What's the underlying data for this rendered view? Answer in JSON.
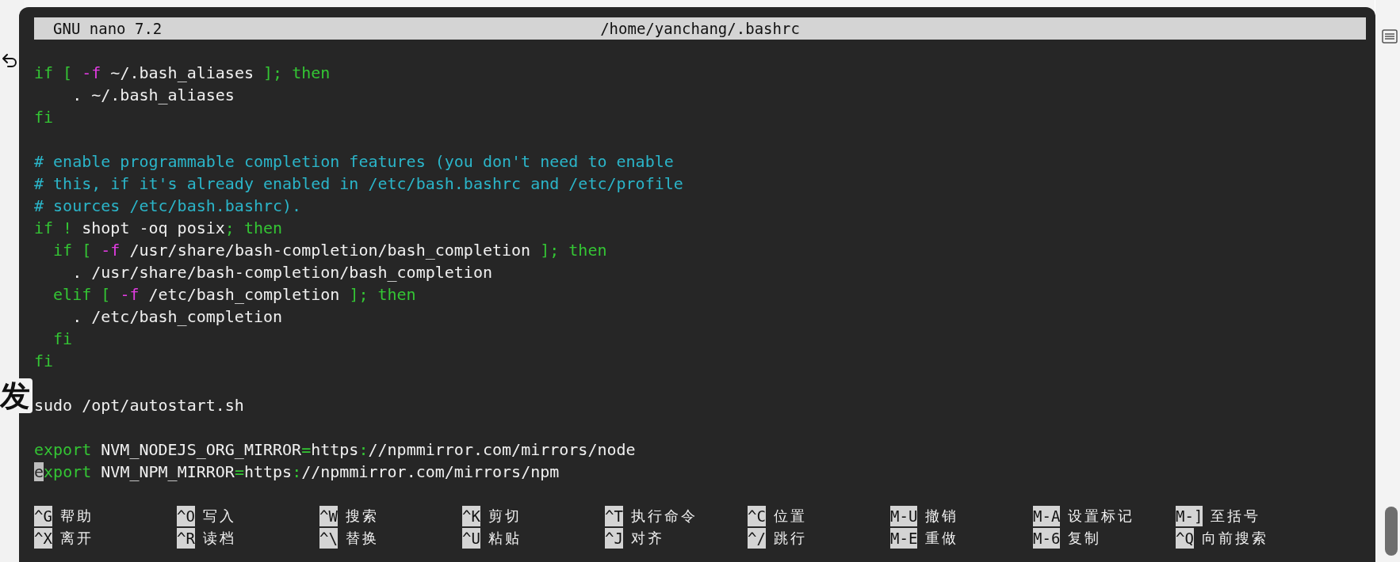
{
  "page": {
    "heading_fragment": "发"
  },
  "nano": {
    "title_left": "GNU nano 7.2",
    "title_file": "/home/yanchang/.bashrc",
    "lines": [
      {
        "kind": "code",
        "segments": [
          {
            "text": "if [ ",
            "kind": "keyword"
          },
          {
            "text": "-f",
            "kind": "flag"
          },
          {
            "text": " ~/.bash_aliases ",
            "kind": "plain"
          },
          {
            "text": "]; then",
            "kind": "keyword"
          }
        ]
      },
      {
        "kind": "code",
        "segments": [
          {
            "text": "    . ~/.bash_aliases",
            "kind": "plain"
          }
        ]
      },
      {
        "kind": "code",
        "segments": [
          {
            "text": "fi",
            "kind": "keyword"
          }
        ]
      },
      {
        "kind": "blank"
      },
      {
        "kind": "code",
        "segments": [
          {
            "text": "# enable programmable completion features (you don't need to enable",
            "kind": "comment"
          }
        ]
      },
      {
        "kind": "code",
        "segments": [
          {
            "text": "# this, if it's already enabled in /etc/bash.bashrc and /etc/profile",
            "kind": "comment"
          }
        ]
      },
      {
        "kind": "code",
        "segments": [
          {
            "text": "# sources /etc/bash.bashrc).",
            "kind": "comment"
          }
        ]
      },
      {
        "kind": "code",
        "segments": [
          {
            "text": "if !",
            "kind": "keyword"
          },
          {
            "text": " shopt -oq posix",
            "kind": "plain"
          },
          {
            "text": "; then",
            "kind": "keyword"
          }
        ]
      },
      {
        "kind": "code",
        "segments": [
          {
            "text": "  if [ ",
            "kind": "keyword"
          },
          {
            "text": "-f",
            "kind": "flag"
          },
          {
            "text": " /usr/share/bash-completion/bash_completion ",
            "kind": "plain"
          },
          {
            "text": "]; then",
            "kind": "keyword"
          }
        ]
      },
      {
        "kind": "code",
        "segments": [
          {
            "text": "    . /usr/share/bash-completion/bash_completion",
            "kind": "plain"
          }
        ]
      },
      {
        "kind": "code",
        "segments": [
          {
            "text": "  elif [ ",
            "kind": "keyword"
          },
          {
            "text": "-f",
            "kind": "flag"
          },
          {
            "text": " /etc/bash_completion ",
            "kind": "plain"
          },
          {
            "text": "]; then",
            "kind": "keyword"
          }
        ]
      },
      {
        "kind": "code",
        "segments": [
          {
            "text": "    . /etc/bash_completion",
            "kind": "plain"
          }
        ]
      },
      {
        "kind": "code",
        "segments": [
          {
            "text": "  fi",
            "kind": "keyword"
          }
        ]
      },
      {
        "kind": "code",
        "segments": [
          {
            "text": "fi",
            "kind": "keyword"
          }
        ]
      },
      {
        "kind": "blank"
      },
      {
        "kind": "code",
        "segments": [
          {
            "text": "sudo /opt/autostart.sh",
            "kind": "plain"
          }
        ]
      },
      {
        "kind": "blank"
      },
      {
        "kind": "code",
        "segments": [
          {
            "text": "export",
            "kind": "keyword"
          },
          {
            "text": " NVM_NODEJS_ORG_MIRROR",
            "kind": "plain"
          },
          {
            "text": "=",
            "kind": "keyword"
          },
          {
            "text": "https",
            "kind": "plain"
          },
          {
            "text": ":",
            "kind": "keyword"
          },
          {
            "text": "//npmmirror.com/mirrors/node",
            "kind": "plain"
          }
        ]
      },
      {
        "kind": "code",
        "segments": [
          {
            "text": "e",
            "kind": "cursor"
          },
          {
            "text": "xport",
            "kind": "keyword"
          },
          {
            "text": " NVM_NPM_MIRROR",
            "kind": "plain"
          },
          {
            "text": "=",
            "kind": "keyword"
          },
          {
            "text": "https",
            "kind": "plain"
          },
          {
            "text": ":",
            "kind": "keyword"
          },
          {
            "text": "//npmmirror.com/mirrors/npm",
            "kind": "plain"
          }
        ]
      },
      {
        "kind": "blank"
      }
    ],
    "shortcuts": [
      {
        "key": "^G",
        "label": "帮助"
      },
      {
        "key": "^O",
        "label": "写入"
      },
      {
        "key": "^W",
        "label": "搜索"
      },
      {
        "key": "^K",
        "label": "剪切"
      },
      {
        "key": "^T",
        "label": "执行命令"
      },
      {
        "key": "^C",
        "label": "位置"
      },
      {
        "key": "M-U",
        "label": "撤销"
      },
      {
        "key": "M-A",
        "label": "设置标记"
      },
      {
        "key": "M-]",
        "label": "至括号"
      },
      {
        "key": "^X",
        "label": "离开"
      },
      {
        "key": "^R",
        "label": "读档"
      },
      {
        "key": "^\\",
        "label": "替换"
      },
      {
        "key": "^U",
        "label": "粘贴"
      },
      {
        "key": "^J",
        "label": "对齐"
      },
      {
        "key": "^/",
        "label": "跳行"
      },
      {
        "key": "M-E",
        "label": "重做"
      },
      {
        "key": "M-6",
        "label": "复制"
      },
      {
        "key": "^Q",
        "label": "向前搜索"
      }
    ]
  }
}
